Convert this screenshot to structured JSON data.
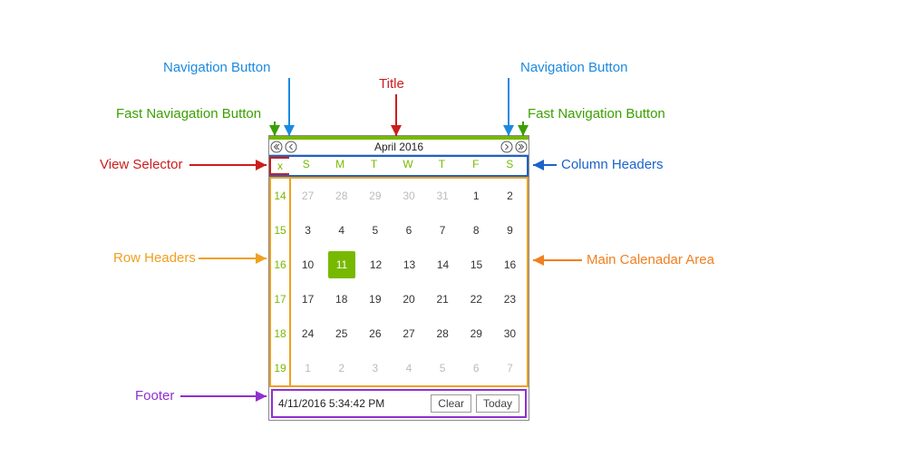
{
  "annotations": {
    "nav_button": "Navigation Button",
    "fast_nav_left": "Fast Naviagation Button",
    "fast_nav_right": "Fast Navigation Button",
    "title": "Title",
    "view_selector": "View Selector",
    "column_headers": "Column Headers",
    "row_headers": "Row Headers",
    "main_area": "Main Calenadar Area",
    "footer": "Footer"
  },
  "calendar": {
    "title": "April 2016",
    "view_selector": "x",
    "dow": [
      "S",
      "M",
      "T",
      "W",
      "T",
      "F",
      "S"
    ],
    "weeks": [
      "14",
      "15",
      "16",
      "17",
      "18",
      "19"
    ],
    "grid": [
      [
        {
          "d": "27",
          "o": true
        },
        {
          "d": "28",
          "o": true
        },
        {
          "d": "29",
          "o": true
        },
        {
          "d": "30",
          "o": true
        },
        {
          "d": "31",
          "o": true
        },
        {
          "d": "1"
        },
        {
          "d": "2"
        }
      ],
      [
        {
          "d": "3"
        },
        {
          "d": "4"
        },
        {
          "d": "5"
        },
        {
          "d": "6"
        },
        {
          "d": "7"
        },
        {
          "d": "8"
        },
        {
          "d": "9"
        }
      ],
      [
        {
          "d": "10"
        },
        {
          "d": "11",
          "sel": true
        },
        {
          "d": "12"
        },
        {
          "d": "13"
        },
        {
          "d": "14"
        },
        {
          "d": "15"
        },
        {
          "d": "16"
        }
      ],
      [
        {
          "d": "17"
        },
        {
          "d": "18"
        },
        {
          "d": "19"
        },
        {
          "d": "20"
        },
        {
          "d": "21"
        },
        {
          "d": "22"
        },
        {
          "d": "23"
        }
      ],
      [
        {
          "d": "24"
        },
        {
          "d": "25"
        },
        {
          "d": "26"
        },
        {
          "d": "27"
        },
        {
          "d": "28"
        },
        {
          "d": "29"
        },
        {
          "d": "30"
        }
      ],
      [
        {
          "d": "1",
          "o": true
        },
        {
          "d": "2",
          "o": true
        },
        {
          "d": "3",
          "o": true
        },
        {
          "d": "4",
          "o": true
        },
        {
          "d": "5",
          "o": true
        },
        {
          "d": "6",
          "o": true
        },
        {
          "d": "7",
          "o": true
        }
      ]
    ],
    "footer": {
      "datetime": "4/11/2016 5:34:42 PM",
      "clear": "Clear",
      "today": "Today"
    }
  }
}
